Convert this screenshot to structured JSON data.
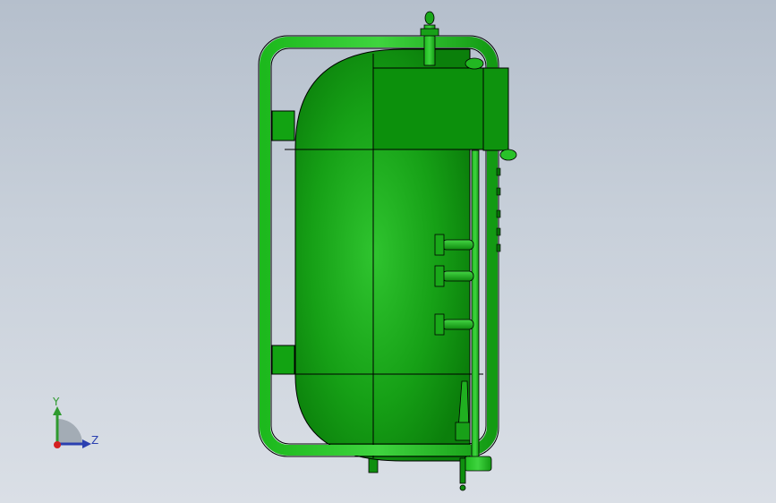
{
  "viewport": {
    "background_top": "#b5bfcc",
    "background_bottom": "#dadfe6"
  },
  "model": {
    "name": "pressure-tank-assembly",
    "color": "#14a814",
    "shade_dark": "#0a7d0a",
    "shade_light": "#3ccf3c",
    "nozzle_count": 3
  },
  "triad": {
    "y_label": "Y",
    "z_label": "Z",
    "y_color": "#2f9a2f",
    "z_color": "#2a3fb0",
    "x_color": "#d42020"
  }
}
